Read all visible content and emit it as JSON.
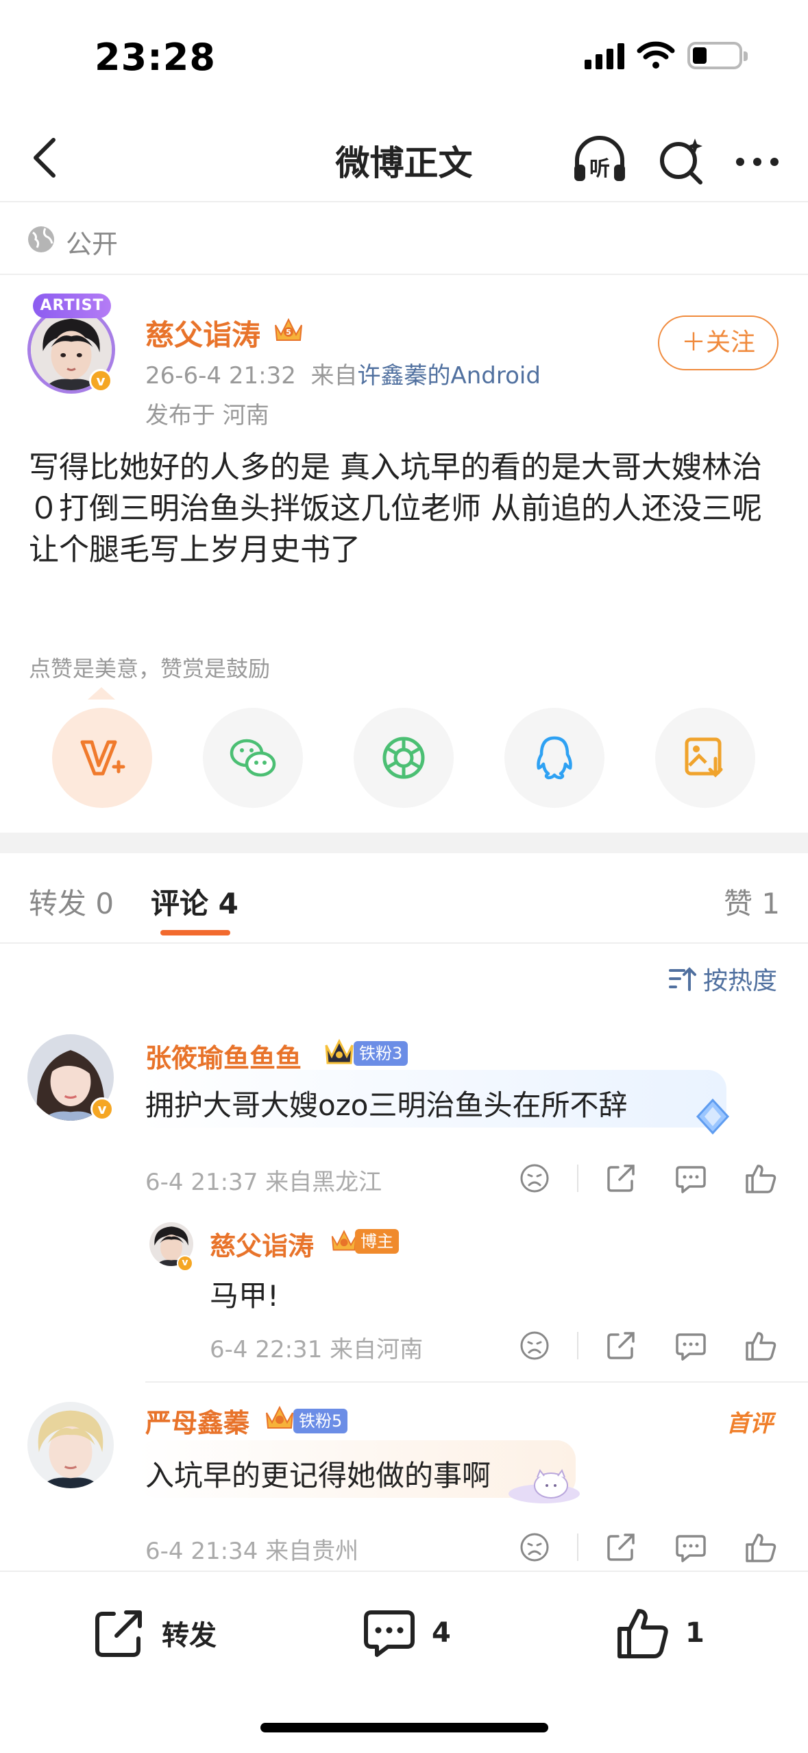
{
  "status_bar": {
    "time": "23:28"
  },
  "nav": {
    "title": "微博正文",
    "listen_label": "听"
  },
  "visibility": {
    "label": "公开"
  },
  "post": {
    "avatar_badge": "ARTIST",
    "author": "慈父诣涛",
    "date": "26-6-4 21:32",
    "source_prefix": "来自",
    "source": "许鑫蓁的Android",
    "location": "发布于 河南",
    "follow_label": "＋关注",
    "text": "写得比她好的人多的是 真入坑早的看的是大哥大嫂林治０打倒三明治鱼头拌饭这几位老师 从前追的人还没三呢 让个腿毛写上岁月史书了"
  },
  "reward": {
    "hint": "点赞是美意，赞赏是鼓励"
  },
  "share_options": [
    "reward-icon",
    "wechat-icon",
    "moments-icon",
    "qq-icon",
    "save-image-icon"
  ],
  "tabs": {
    "repost": "转发 0",
    "comments": "评论 4",
    "likes": "赞 1"
  },
  "sort": {
    "label": "按热度"
  },
  "comments": [
    {
      "author": "张筱瑜鱼鱼鱼",
      "badge": "铁粉3",
      "text": "拥护大哥大嫂ozo三明治鱼头在所不辞",
      "time": "6-4 21:37  来自黑龙江",
      "reply": {
        "author": "慈父诣涛",
        "badge": "博主",
        "text": "马甲!",
        "time": "6-4 22:31  来自河南"
      }
    },
    {
      "author": "严母鑫蓁",
      "badge": "铁粉5",
      "tag": "首评",
      "text": "入坑早的更记得她做的事啊",
      "time": "6-4 21:34  来自贵州"
    }
  ],
  "bottom_bar": {
    "repost": "转发",
    "comments": "4",
    "likes": "1"
  },
  "colors": {
    "accent": "#e8732a",
    "link": "#50709f",
    "tab_indicator": "#f26a2e"
  }
}
